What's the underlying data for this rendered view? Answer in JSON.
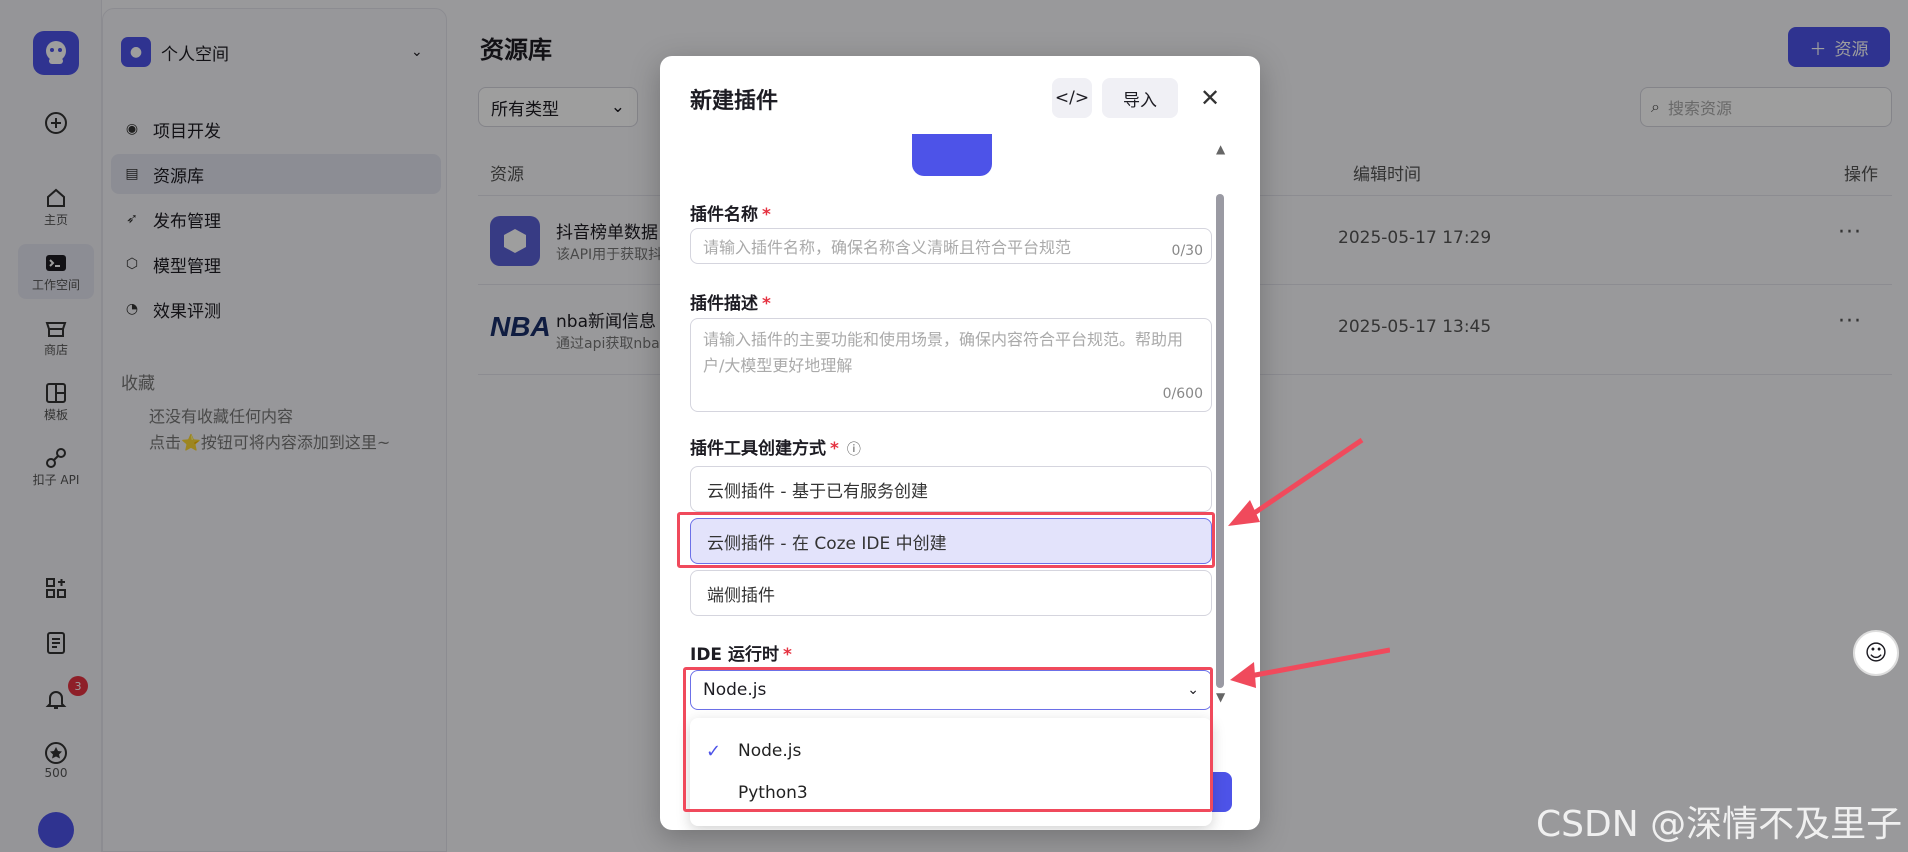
{
  "rail": {
    "items": [
      {
        "label": "主页",
        "icon": "home-icon"
      },
      {
        "label": "工作空间",
        "icon": "terminal-icon"
      },
      {
        "label": "商店",
        "icon": "store-icon"
      },
      {
        "label": "模板",
        "icon": "template-icon"
      },
      {
        "label": "扣子 API",
        "icon": "api-icon"
      }
    ],
    "notification_count": "3",
    "credits": "500"
  },
  "sidebar": {
    "space_name": "个人空间",
    "nav": [
      "项目开发",
      "资源库",
      "发布管理",
      "模型管理",
      "效果评测"
    ],
    "favorites_title": "收藏",
    "favorites_empty_1": "还没有收藏任何内容",
    "favorites_empty_2": "点击⭐按钮可将内容添加到这里~"
  },
  "main": {
    "title": "资源库",
    "add_button": "资源",
    "type_filter": "所有类型",
    "search_placeholder": "搜索资源",
    "columns": {
      "resource": "资源",
      "edited": "编辑时间",
      "actions": "操作"
    },
    "rows": [
      {
        "name": "抖音榜单数据",
        "desc": "该API用于获取抖",
        "time": "2025-05-17 17:29"
      },
      {
        "name": "nba新闻信息",
        "desc": "通过api获取nba",
        "time": "2025-05-17 13:45"
      }
    ]
  },
  "modal": {
    "title": "新建插件",
    "import_button": "导入",
    "name_label": "插件名称",
    "name_placeholder": "请输入插件名称，确保名称含义清晰且符合平台规范",
    "name_counter": "0/30",
    "desc_label": "插件描述",
    "desc_placeholder": "请输入插件的主要功能和使用场景，确保内容符合平台规范。帮助用户/大模型更好地理解",
    "desc_counter": "0/600",
    "method_label": "插件工具创建方式",
    "methods": [
      "云侧插件 - 基于已有服务创建",
      "云侧插件 - 在 Coze IDE 中创建",
      "端侧插件"
    ],
    "selected_method_index": 1,
    "runtime_label": "IDE 运行时",
    "runtime_value": "Node.js",
    "runtime_options": [
      "Node.js",
      "Python3"
    ]
  },
  "watermark": "CSDN @深情不及里子",
  "colors": {
    "brand": "#4d53e8",
    "highlight": "#f04a5c",
    "required": "#e53241"
  }
}
